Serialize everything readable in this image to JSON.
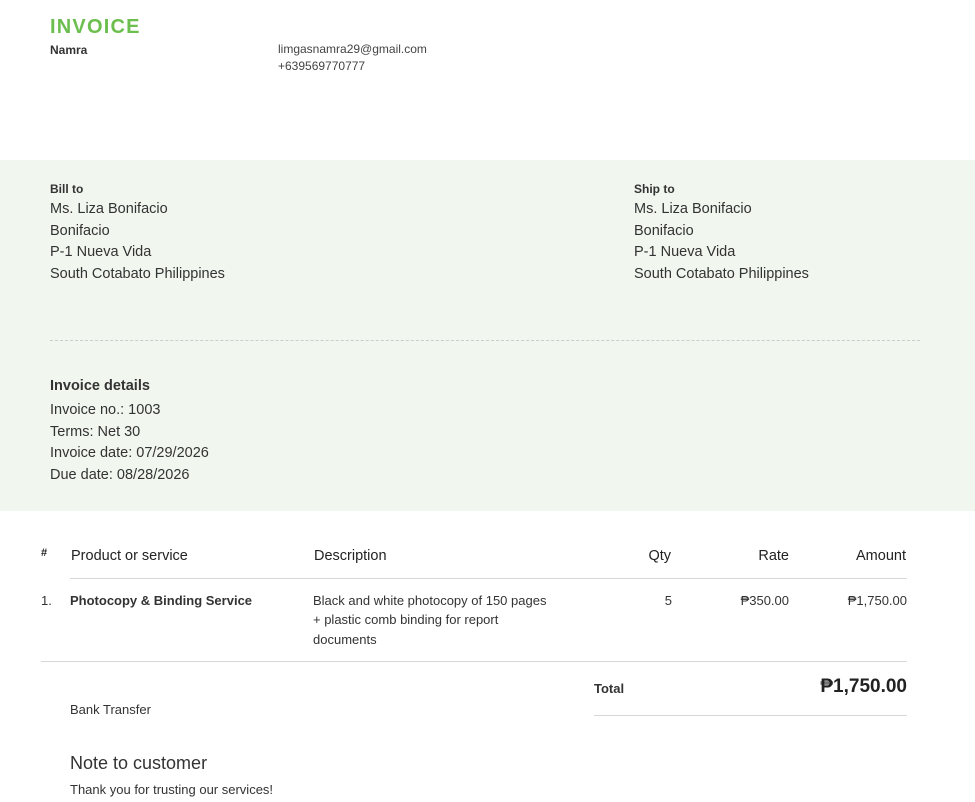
{
  "header": {
    "title": "INVOICE",
    "company": "Namra",
    "email": "limgasnamra29@gmail.com",
    "phone": "+639569770777"
  },
  "bill_to": {
    "label": "Bill to",
    "lines": [
      "Ms. Liza Bonifacio",
      "Bonifacio",
      "P-1 Nueva Vida",
      "South Cotabato Philippines"
    ]
  },
  "ship_to": {
    "label": "Ship to",
    "lines": [
      "Ms. Liza Bonifacio",
      "Bonifacio",
      "P-1 Nueva Vida",
      "South Cotabato Philippines"
    ]
  },
  "details": {
    "title": "Invoice details",
    "invoice_no": "Invoice no.: 1003",
    "terms": "Terms: Net 30",
    "invoice_date": "Invoice date: 07/29/2026",
    "due_date": "Due date: 08/28/2026"
  },
  "table": {
    "headers": {
      "num": "#",
      "product": "Product or service",
      "description": "Description",
      "qty": "Qty",
      "rate": "Rate",
      "amount": "Amount"
    },
    "rows": [
      {
        "num": "1.",
        "product": "Photocopy & Binding Service",
        "description_lines": [
          "Black and white photocopy of 150 pages",
          "+ plastic comb binding for report",
          "documents"
        ],
        "qty": "5",
        "rate": "₱350.00",
        "amount": "₱1,750.00"
      }
    ]
  },
  "totals": {
    "label": "Total",
    "value": "₱1,750.00"
  },
  "payment_method": "Bank Transfer",
  "note": {
    "title": "Note to customer",
    "text": "Thank you for trusting our services!"
  },
  "colors": {
    "accent": "#6cbf4f",
    "band_background": "#f1f6ef"
  }
}
